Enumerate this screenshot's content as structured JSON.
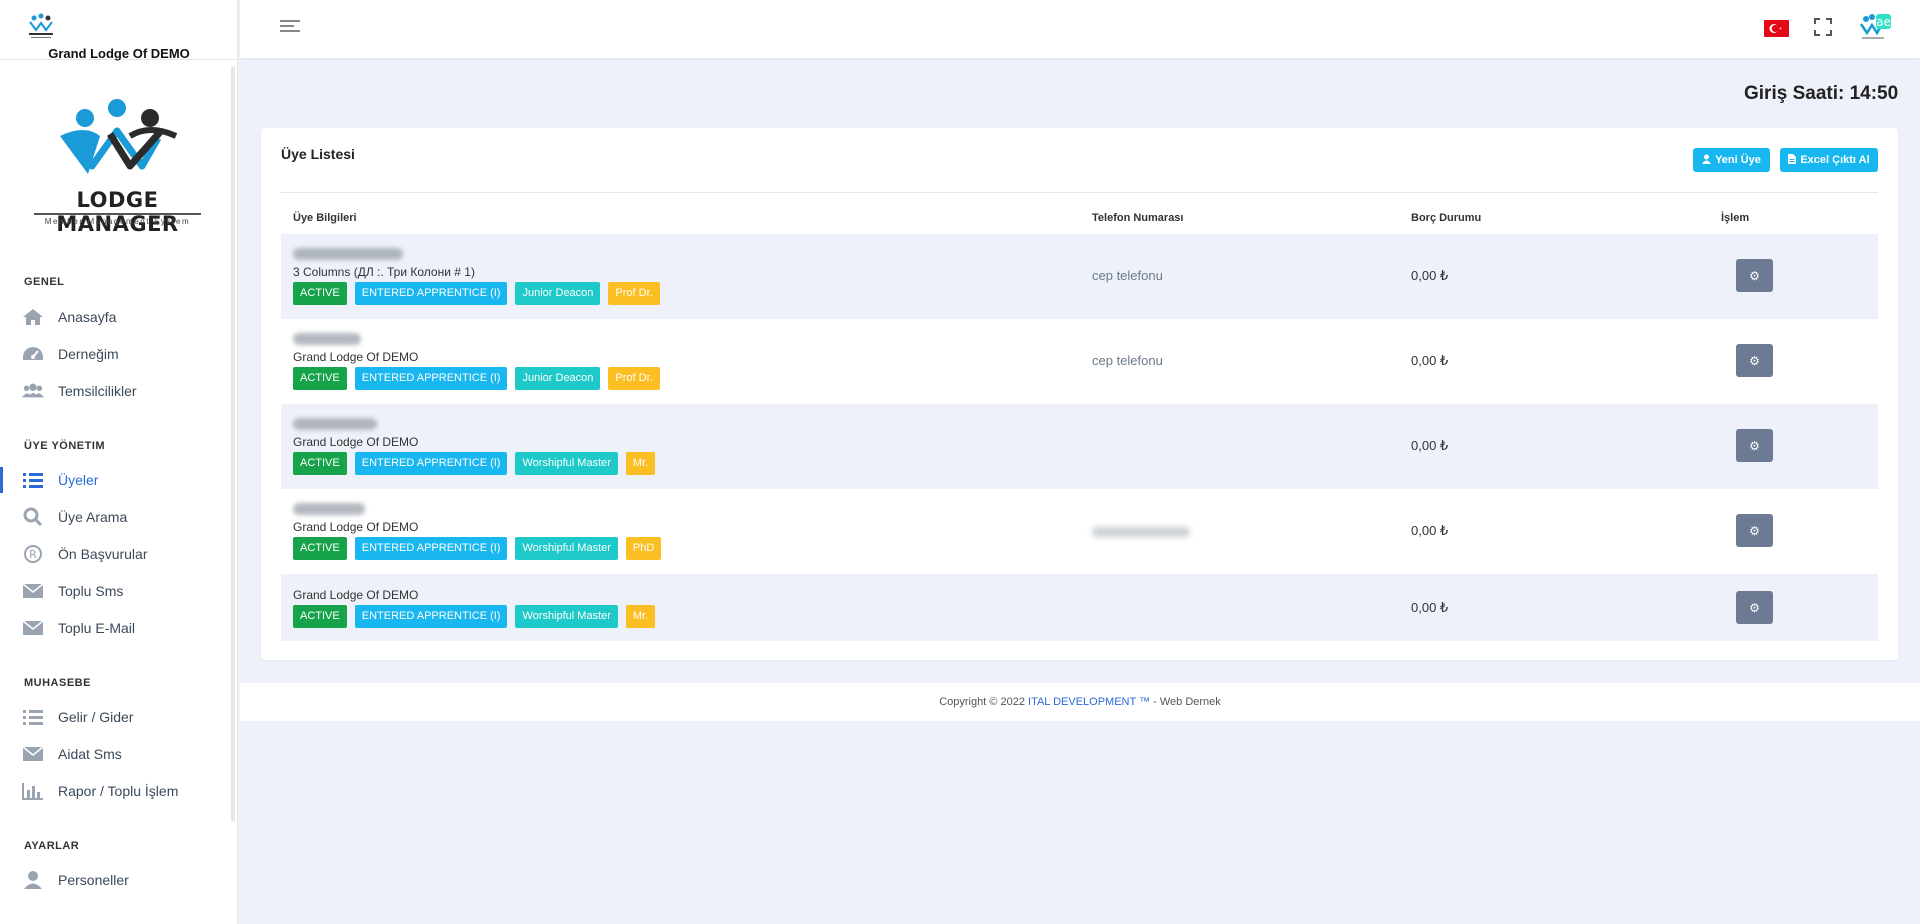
{
  "sidebar": {
    "org_name": "Grand Lodge Of DEMO",
    "brand": "LODGE MANAGER",
    "tagline": "Member Management System",
    "sections": [
      {
        "title": "GENEL"
      },
      {
        "title": "ÜYE YÖNETIM"
      },
      {
        "title": "MUHASEBE"
      },
      {
        "title": "AYARLAR"
      }
    ],
    "items": [
      {
        "label": "Anasayfa",
        "icon": "home-icon"
      },
      {
        "label": "Derneğim",
        "icon": "dashboard-icon"
      },
      {
        "label": "Temsilcilikler",
        "icon": "users-icon"
      },
      {
        "label": "Üyeler",
        "icon": "list-icon",
        "active": true
      },
      {
        "label": "Üye Arama",
        "icon": "search-icon"
      },
      {
        "label": "Ön Başvurular",
        "icon": "registered-icon"
      },
      {
        "label": "Toplu Sms",
        "icon": "envelope-icon"
      },
      {
        "label": "Toplu E-Mail",
        "icon": "envelope-icon"
      },
      {
        "label": "Gelir / Gider",
        "icon": "list-icon"
      },
      {
        "label": "Aidat Sms",
        "icon": "envelope-icon"
      },
      {
        "label": "Rapor / Toplu İşlem",
        "icon": "bar-chart-icon"
      },
      {
        "label": "Personeller",
        "icon": "user-icon"
      }
    ]
  },
  "header": {
    "login_time": "Giriş Saati: 14:50",
    "icons": [
      "menu-icon",
      "turkey-flag-icon",
      "fullscreen-icon",
      "avatar-icon"
    ]
  },
  "card": {
    "title": "Üye Listesi",
    "new_member_label": "Yeni Üye",
    "excel_label": "Excel Çıktı Al",
    "columns": {
      "member": "Üye Bilgileri",
      "phone": "Telefon Numarası",
      "debt": "Borç Durumu",
      "action": "İşlem"
    },
    "rows": [
      {
        "org": "3 Columns (ДЛ :. Три Колони # 1)",
        "phone": "cep telefonu",
        "debt": "0,00 ₺",
        "badges": [
          "ACTIVE",
          "ENTERED APPRENTICE (I)",
          "Junior Deacon",
          "Prof Dr."
        ]
      },
      {
        "org": "Grand Lodge Of DEMO",
        "phone": "cep telefonu",
        "debt": "0,00 ₺",
        "badges": [
          "ACTIVE",
          "ENTERED APPRENTICE (I)",
          "Junior Deacon",
          "Prof Dr."
        ]
      },
      {
        "org": "Grand Lodge Of DEMO",
        "phone": "",
        "debt": "0,00 ₺",
        "badges": [
          "ACTIVE",
          "ENTERED APPRENTICE (I)",
          "Worshipful Master",
          "Mr."
        ]
      },
      {
        "org": "Grand Lodge Of DEMO",
        "phone": "",
        "debt": "0,00 ₺",
        "badges": [
          "ACTIVE",
          "ENTERED APPRENTICE (I)",
          "Worshipful Master",
          "PhD"
        ]
      },
      {
        "org": "Grand Lodge Of DEMO",
        "phone": "",
        "debt": "0,00 ₺",
        "badges": [
          "ACTIVE",
          "ENTERED APPRENTICE (I)",
          "Worshipful Master",
          "Mr."
        ]
      }
    ]
  },
  "footer": {
    "prefix": "Copyright © 2022",
    "company": "ITAL DEVELOPMENT ™",
    "suffix": "- Web Dernek"
  },
  "colors": {
    "accent": "#2a6bd7",
    "button": "#18b7ef",
    "badge_active": "#17a34a",
    "badge_degree": "#18b7ef",
    "badge_role": "#1ec9c9",
    "badge_title": "#fbbf24",
    "gear_button": "#6c7a93",
    "page_bg": "#eef1f9"
  }
}
